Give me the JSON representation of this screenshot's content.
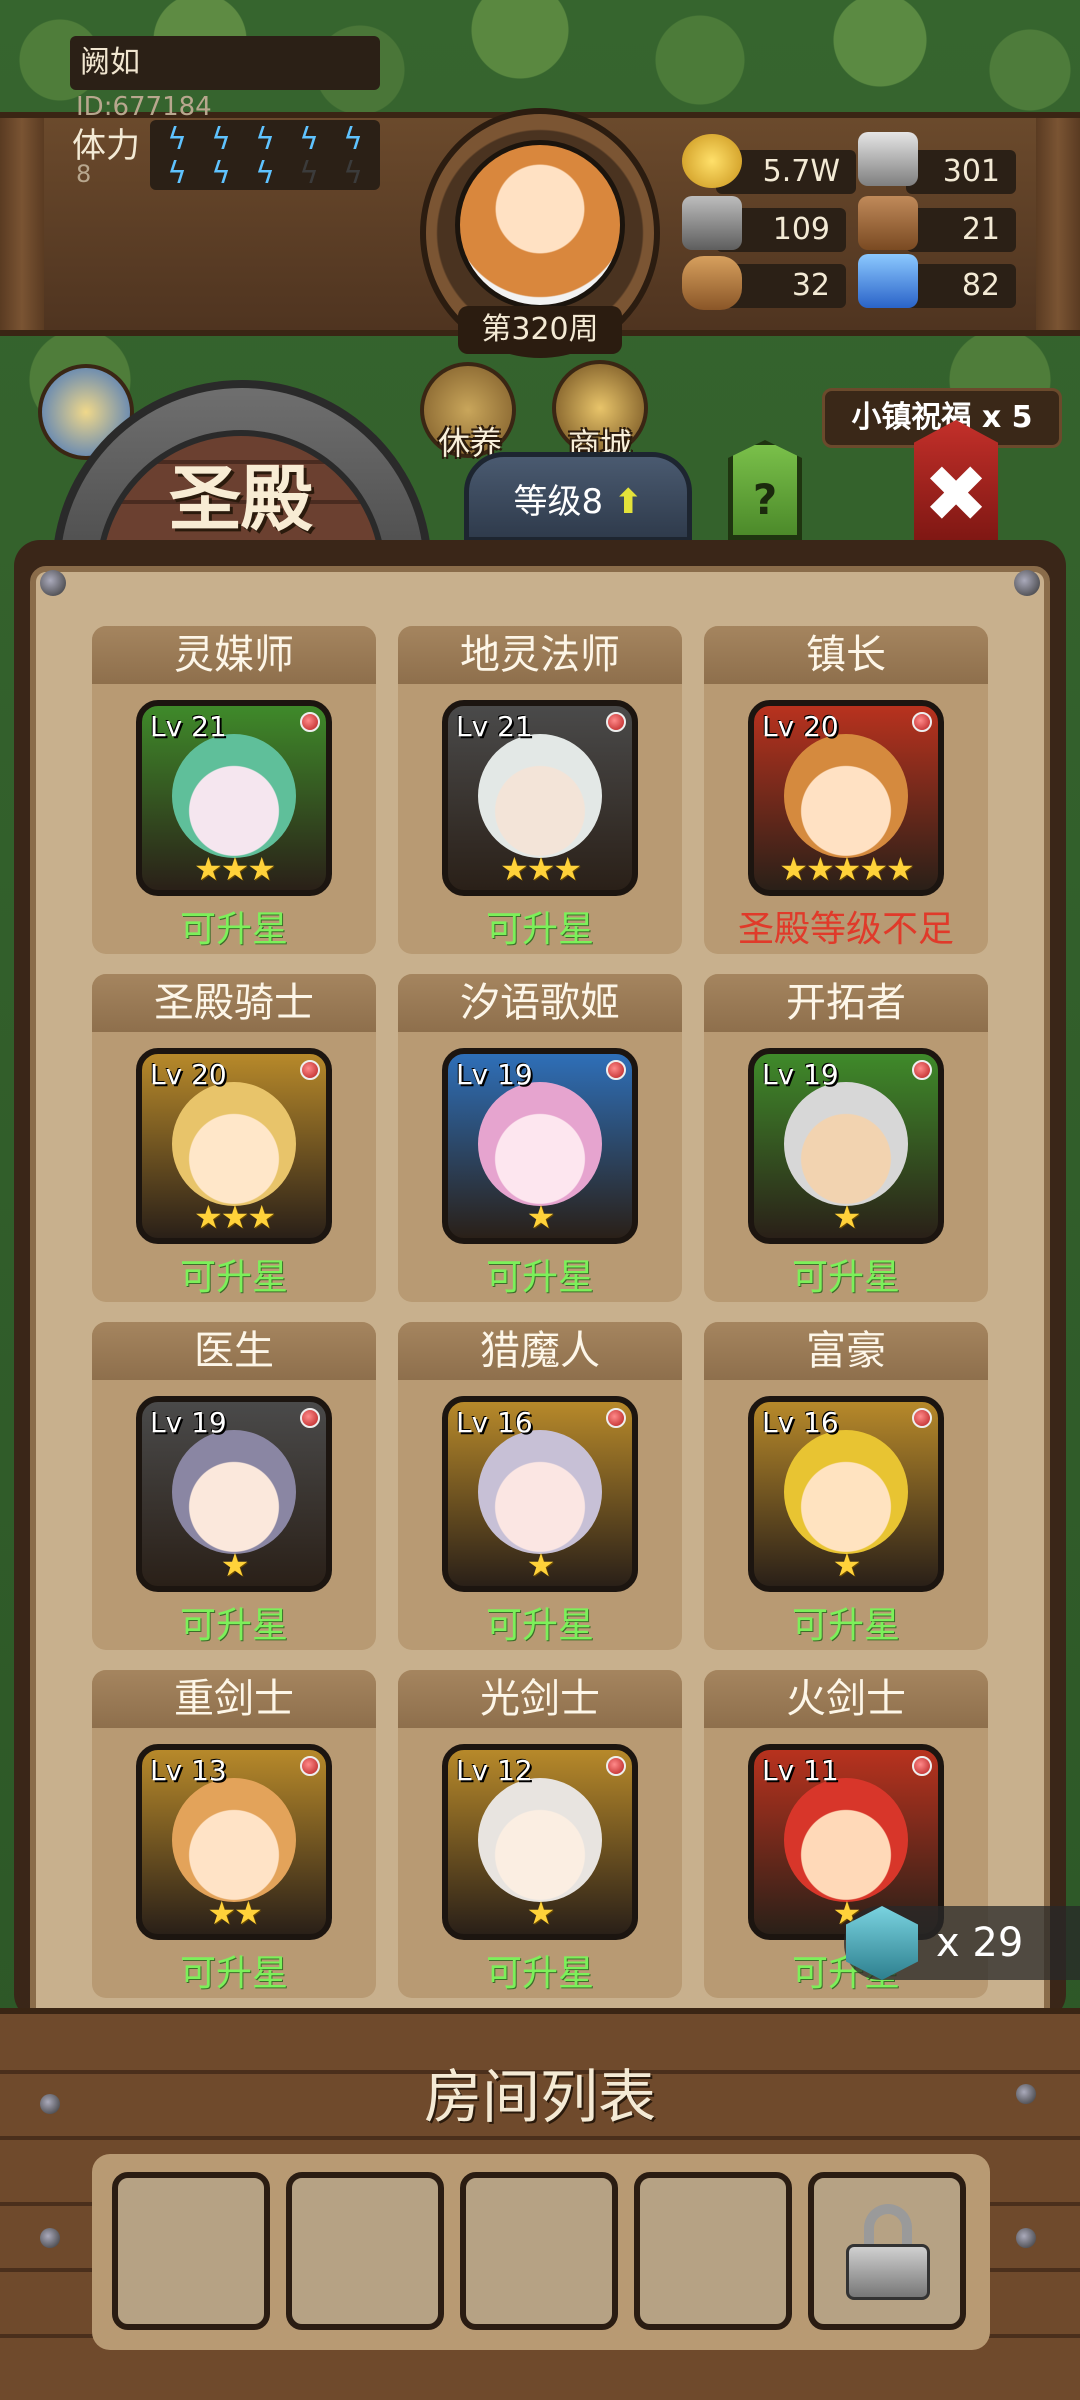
{
  "player": {
    "name": "阙如",
    "id": "ID:677184",
    "stamina_label": "体力",
    "stamina_value": "8",
    "week": "第320周"
  },
  "resources": {
    "gold": "5.7W",
    "iron": "301",
    "stone": "109",
    "leather": "21",
    "wood": "32",
    "crystal": "82"
  },
  "nav": {
    "rest_label": "休养",
    "shop_label": "商城",
    "blessing": "小镇祝福 x 5"
  },
  "temple": {
    "title": "圣殿",
    "level": "等级8",
    "help": "?"
  },
  "heroes": [
    {
      "name": "灵媒师",
      "level": "Lv 21",
      "stars": 3,
      "status": "可升星",
      "warn": false,
      "frame": "#3f8a2a",
      "skin": "#f5e6ef",
      "hair": "#5fbf9a"
    },
    {
      "name": "地灵法师",
      "level": "Lv 21",
      "stars": 3,
      "status": "可升星",
      "warn": false,
      "frame": "#4a4a4a",
      "skin": "#f3e4d8",
      "hair": "#e3e8e6"
    },
    {
      "name": "镇长",
      "level": "Lv 20",
      "stars": 5,
      "status": "圣殿等级不足",
      "warn": true,
      "frame": "#b8321e",
      "skin": "#ffe1c3",
      "hair": "#d58a3e"
    },
    {
      "name": "圣殿骑士",
      "level": "Lv 20",
      "stars": 3,
      "status": "可升星",
      "warn": false,
      "frame": "#b7892a",
      "skin": "#ffe7c9",
      "hair": "#e8c46a"
    },
    {
      "name": "汐语歌姬",
      "level": "Lv 19",
      "stars": 1,
      "status": "可升星",
      "warn": false,
      "frame": "#2e6fb8",
      "skin": "#fde6ef",
      "hair": "#e6a4cf"
    },
    {
      "name": "开拓者",
      "level": "Lv 19",
      "stars": 1,
      "status": "可升星",
      "warn": false,
      "frame": "#3f8a2a",
      "skin": "#f2d3b0",
      "hair": "#d7d7d7"
    },
    {
      "name": "医生",
      "level": "Lv 19",
      "stars": 1,
      "status": "可升星",
      "warn": false,
      "frame": "#4a4a4a",
      "skin": "#fbe8dc",
      "hair": "#8a86a3"
    },
    {
      "name": "猎魔人",
      "level": "Lv 16",
      "stars": 1,
      "status": "可升星",
      "warn": false,
      "frame": "#b7892a",
      "skin": "#fbe6e3",
      "hair": "#c7c0d6"
    },
    {
      "name": "富豪",
      "level": "Lv 16",
      "stars": 1,
      "status": "可升星",
      "warn": false,
      "frame": "#b7892a",
      "skin": "#ffe3c0",
      "hair": "#e8c432"
    },
    {
      "name": "重剑士",
      "level": "Lv 13",
      "stars": 2,
      "status": "可升星",
      "warn": false,
      "frame": "#b7892a",
      "skin": "#ffe3c6",
      "hair": "#e3a35a"
    },
    {
      "name": "光剑士",
      "level": "Lv 12",
      "stars": 1,
      "status": "可升星",
      "warn": false,
      "frame": "#b7892a",
      "skin": "#fbeee2",
      "hair": "#e8e4e0"
    },
    {
      "name": "火剑士",
      "level": "Lv 11",
      "stars": 1,
      "status": "可升星",
      "warn": false,
      "frame": "#b8321e",
      "skin": "#ffd9b8",
      "hair": "#d8362a"
    }
  ],
  "token": {
    "count": "x 29"
  },
  "rooms": {
    "title": "房间列表"
  },
  "colors": {
    "green_status": "#7cf05a",
    "red_status": "#e03a2a",
    "panel": "#c8b08d"
  }
}
